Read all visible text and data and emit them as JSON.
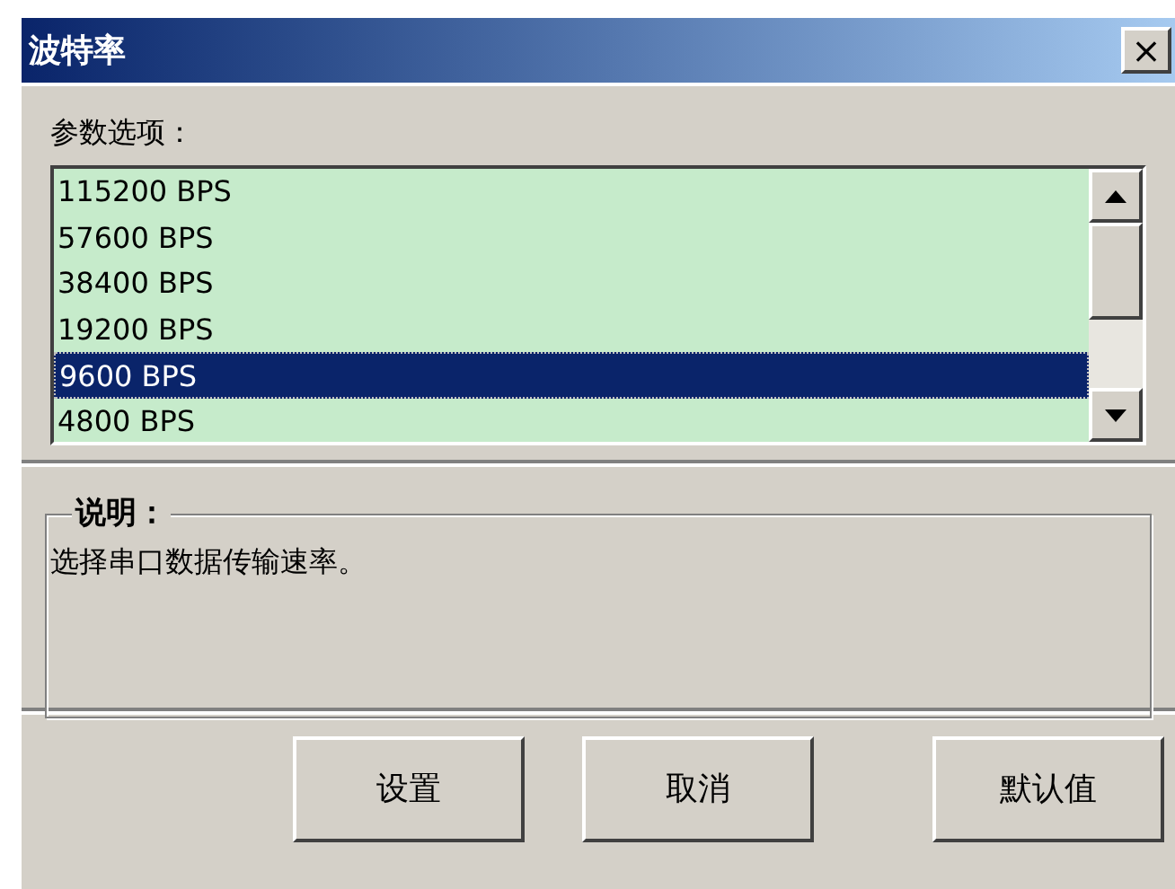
{
  "window": {
    "title": "波特率",
    "close": "×"
  },
  "options": {
    "label": "参数选项：",
    "items": [
      {
        "label": "115200 BPS",
        "selected": false
      },
      {
        "label": "57600 BPS",
        "selected": false
      },
      {
        "label": "38400 BPS",
        "selected": false
      },
      {
        "label": "19200 BPS",
        "selected": false
      },
      {
        "label": "9600 BPS",
        "selected": true
      },
      {
        "label": "4800 BPS",
        "selected": false
      }
    ]
  },
  "description": {
    "title": "说明：",
    "text": "选择串口数据传输速率。"
  },
  "buttons": [
    "设置",
    "取消",
    "默认值"
  ]
}
